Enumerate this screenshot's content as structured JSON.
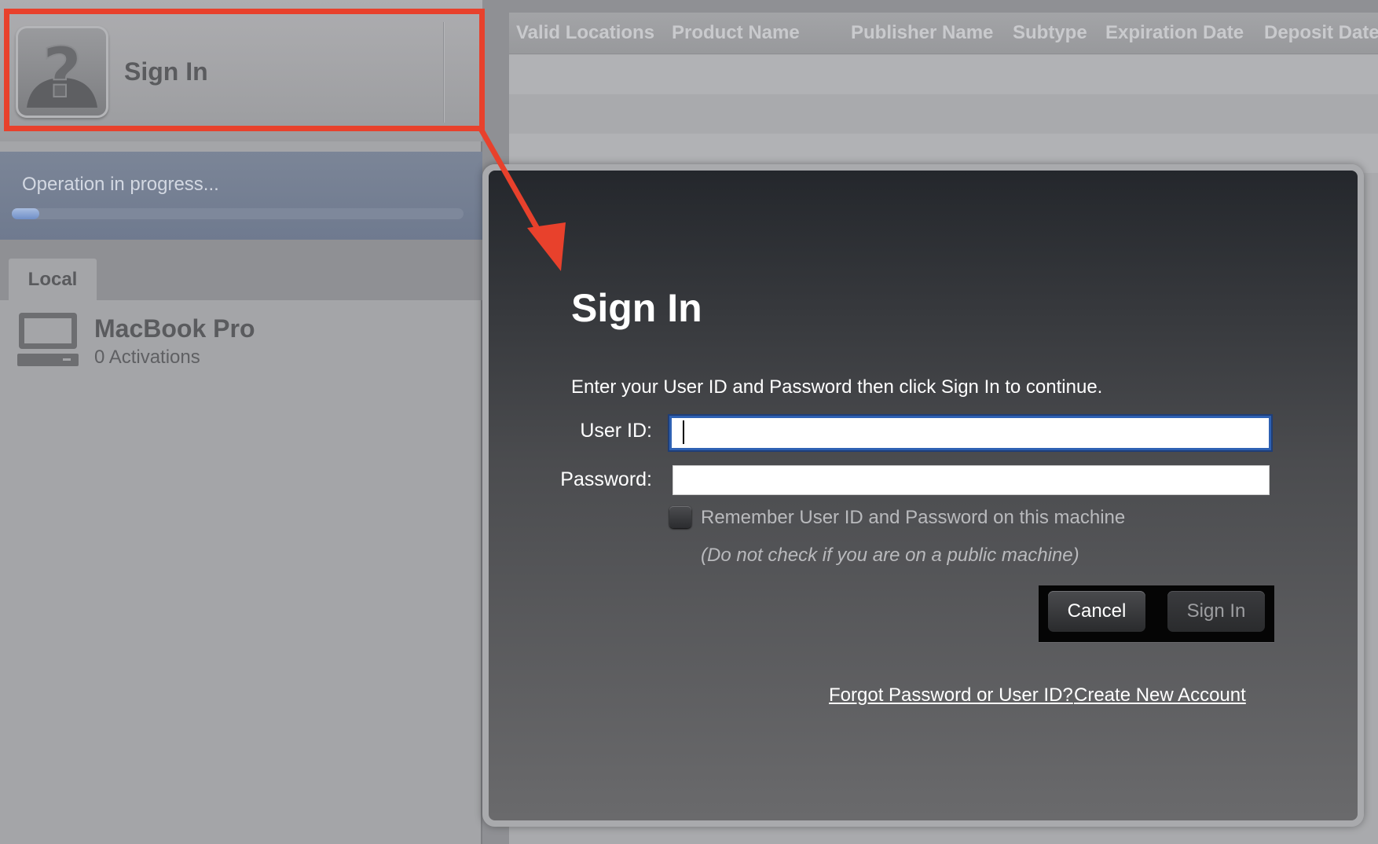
{
  "sidebar": {
    "profile_name": "Sign In",
    "progress": {
      "label": "Operation in progress...",
      "fraction": 0.06
    },
    "tab_label": "Local",
    "device": {
      "name": "MacBook Pro",
      "activations": "0 Activations"
    }
  },
  "table": {
    "columns": [
      "Valid Locations",
      "Product Name",
      "Publisher Name",
      "Subtype",
      "Expiration Date",
      "Deposit Date"
    ]
  },
  "dialog": {
    "title": "Sign In",
    "instructions": "Enter your User ID and Password then click Sign In to continue.",
    "user_id_label": "User ID:",
    "user_id_value": "",
    "password_label": "Password:",
    "password_value": "",
    "remember_label": "Remember User ID and Password on this machine",
    "remember_checked": false,
    "public_note": "(Do not check if you are on a public machine)",
    "cancel_label": "Cancel",
    "signin_label": "Sign In",
    "forgot_link": "Forgot Password or User ID?",
    "create_link": "Create New Account"
  },
  "colors": {
    "annotation": "#e8412c",
    "focus_ring": "#2e61b3",
    "progress_fill": "#6f8fc8"
  }
}
